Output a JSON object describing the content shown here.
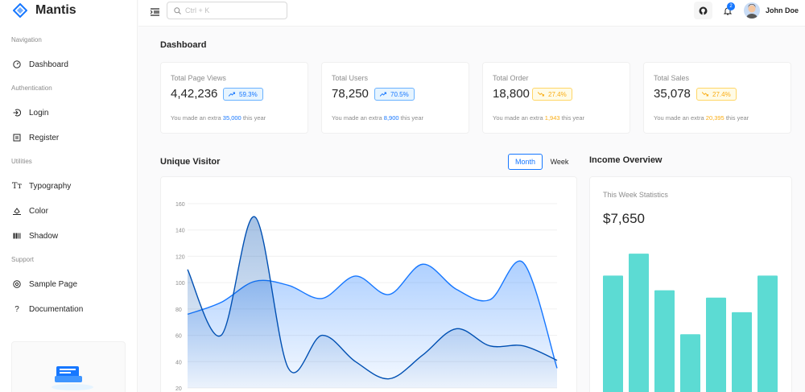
{
  "brand": {
    "name": "Mantis",
    "color": "#1677ff"
  },
  "sidebar": {
    "groups": [
      {
        "label": "Navigation",
        "items": [
          {
            "label": "Dashboard",
            "icon": "dashboard-icon"
          }
        ]
      },
      {
        "label": "Authentication",
        "items": [
          {
            "label": "Login",
            "icon": "login-icon"
          },
          {
            "label": "Register",
            "icon": "register-icon"
          }
        ]
      },
      {
        "label": "Utilities",
        "items": [
          {
            "label": "Typography",
            "icon": "typography-icon"
          },
          {
            "label": "Color",
            "icon": "color-icon"
          },
          {
            "label": "Shadow",
            "icon": "shadow-icon"
          }
        ]
      },
      {
        "label": "Support",
        "items": [
          {
            "label": "Sample Page",
            "icon": "chrome-icon"
          },
          {
            "label": "Documentation",
            "icon": "question-icon"
          }
        ]
      }
    ]
  },
  "header": {
    "search_placeholder": "Ctrl + K",
    "notification_count": "2",
    "user_name": "John Doe"
  },
  "dashboard": {
    "title": "Dashboard",
    "stats": [
      {
        "title": "Total Page Views",
        "value": "4,42,236",
        "change": "59.3%",
        "trend": "up",
        "color": "blue",
        "foot_prefix": "You made an extra",
        "foot_value": "35,000",
        "foot_suffix": "this year"
      },
      {
        "title": "Total Users",
        "value": "78,250",
        "change": "70.5%",
        "trend": "up",
        "color": "blue",
        "foot_prefix": "You made an extra",
        "foot_value": "8,900",
        "foot_suffix": "this year"
      },
      {
        "title": "Total Order",
        "value": "18,800",
        "change": "27.4%",
        "trend": "down",
        "color": "gold",
        "foot_prefix": "You made an extra",
        "foot_value": "1,943",
        "foot_suffix": "this year"
      },
      {
        "title": "Total Sales",
        "value": "35,078",
        "change": "27.4%",
        "trend": "down",
        "color": "gold",
        "foot_prefix": "You made an extra",
        "foot_value": "20,395",
        "foot_suffix": "this year"
      }
    ],
    "unique_visitor": {
      "title": "Unique Visitor",
      "month_label": "Month",
      "week_label": "Week",
      "active": "Month"
    },
    "income": {
      "title": "Income Overview",
      "label": "This Week Statistics",
      "value": "$7,650"
    }
  },
  "chart_data": [
    {
      "type": "area",
      "title": "Unique Visitor",
      "y_ticks": [
        20,
        40,
        60,
        80,
        100,
        120,
        140,
        160
      ],
      "ylim": [
        20,
        160
      ],
      "x": [
        0,
        1,
        2,
        3,
        4,
        5,
        6,
        7,
        8,
        9,
        10,
        11
      ],
      "series": [
        {
          "values": [
            76,
            85,
            101,
            98,
            88,
            105,
            91,
            114,
            95,
            87,
            115,
            35
          ],
          "color": "#1677ff"
        },
        {
          "values": [
            110,
            60,
            150,
            35,
            60,
            40,
            27,
            45,
            65,
            52,
            52,
            41
          ],
          "color": "#0050b3"
        }
      ]
    },
    {
      "type": "bar",
      "title": "Income Overview",
      "values": [
        80,
        95,
        70,
        40,
        65,
        55,
        80
      ],
      "ylim": [
        0,
        100
      ],
      "color": "#5cdbd3"
    }
  ]
}
